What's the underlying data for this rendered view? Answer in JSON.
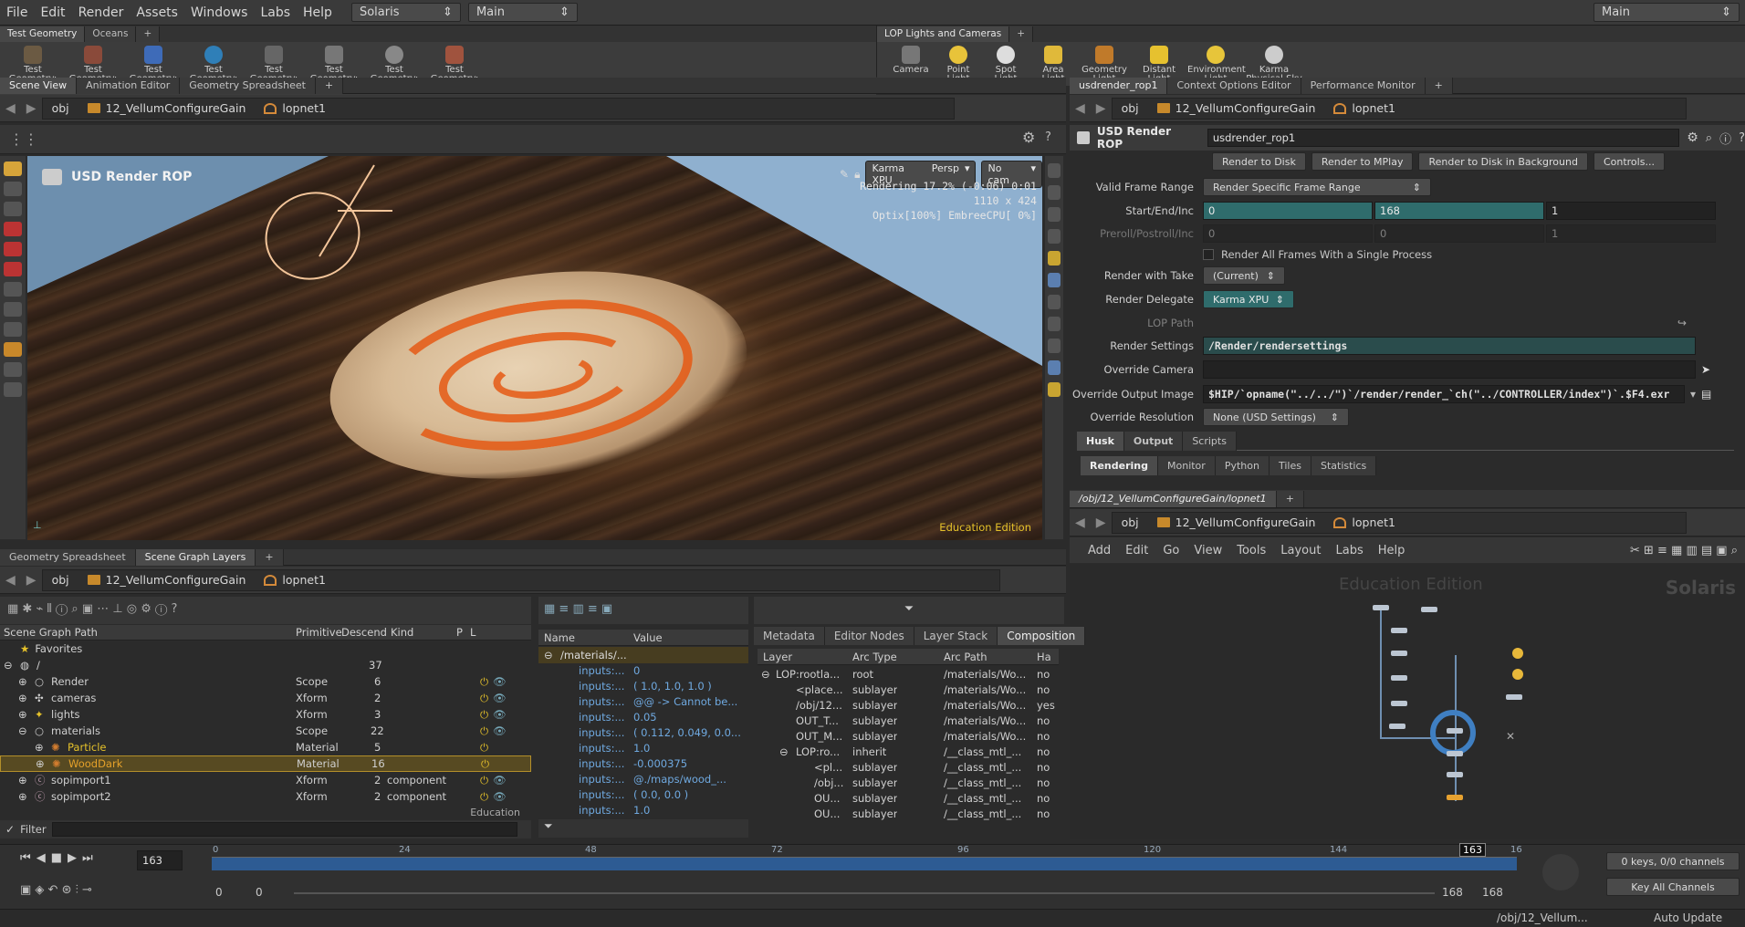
{
  "menu": [
    "File",
    "Edit",
    "Render",
    "Assets",
    "Windows",
    "Labs",
    "Help"
  ],
  "desktop_select": "Solaris",
  "main_select": "Main",
  "top_right_select": "Main",
  "shelf_left": {
    "tabs": [
      "Test Geometry",
      "Oceans"
    ],
    "tools": [
      "Test Geometry: C...",
      "Test Geometry: P...",
      "Test Geometry: R...",
      "Test Geometry: S...",
      "Test Geometry: S...",
      "Test Geometry: T...",
      "Test Geometry: T...",
      "Test Geometry: T..."
    ]
  },
  "shelf_right": {
    "tabs": [
      "LOP Lights and Cameras"
    ],
    "tools": [
      "Camera",
      "Point Light",
      "Spot Light",
      "Area Light",
      "Geometry Light",
      "Distant Light",
      "Environment Light",
      "Karma Physical Sky"
    ]
  },
  "scene_view": {
    "tabs": [
      "Scene View",
      "Animation Editor",
      "Geometry Spreadsheet"
    ],
    "path": [
      "obj",
      "12_VellumConfigureGain",
      "lopnet1"
    ],
    "title": "USD Render ROP",
    "renderer": "Karma XPU",
    "persp": "Persp",
    "cam": "No cam",
    "status_line1": "Rendering  17.2%  (-0:06)  0:01",
    "status_line2": "1110 x 424",
    "status_line3": "Optix[100%] EmbreeCPU[  0%]",
    "watermark": "Education Edition"
  },
  "params": {
    "tabs": [
      "usdrender_rop1",
      "Context Options Editor",
      "Performance Monitor"
    ],
    "path": [
      "obj",
      "12_VellumConfigureGain",
      "lopnet1"
    ],
    "node_type": "USD Render ROP",
    "node_name": "usdrender_rop1",
    "buttons": [
      "Render to Disk",
      "Render to MPlay",
      "Render to Disk in Background",
      "Controls..."
    ],
    "valid_frame_range_label": "Valid Frame Range",
    "valid_frame_range": "Render Specific Frame Range",
    "start_end_inc_label": "Start/End/Inc",
    "start": "0",
    "end": "168",
    "inc": "1",
    "preroll_label": "Preroll/Postroll/Inc",
    "preroll": "0",
    "postroll": "0",
    "preroll_inc": "1",
    "render_all_frames": "Render All Frames With a Single Process",
    "render_with_take_label": "Render with Take",
    "render_with_take": "(Current)",
    "render_delegate_label": "Render Delegate",
    "render_delegate": "Karma XPU",
    "lop_path_label": "LOP Path",
    "render_settings_label": "Render Settings",
    "render_settings": "/Render/rendersettings",
    "override_camera_label": "Override Camera",
    "override_output_label": "Override Output Image",
    "override_output": "$HIP/`opname(\"../../\")`/render/render_`ch(\"../CONTROLLER/index\")`.$F4.exr",
    "override_res_label": "Override Resolution",
    "override_res": "None (USD Settings)",
    "section_tabs": [
      "Husk",
      "Output",
      "Scripts"
    ],
    "sub_tabs": [
      "Rendering",
      "Monitor",
      "Python",
      "Tiles",
      "Statistics"
    ]
  },
  "network": {
    "tab": "/obj/12_VellumConfigureGain/lopnet1",
    "path": [
      "obj",
      "12_VellumConfigureGain",
      "lopnet1"
    ],
    "menu": [
      "Add",
      "Edit",
      "Go",
      "View",
      "Tools",
      "Layout",
      "Labs",
      "Help"
    ],
    "watermark": "Education Edition",
    "context": "Solaris"
  },
  "scene_graph": {
    "tabs": [
      "Geometry Spreadsheet",
      "Scene Graph Layers"
    ],
    "path": [
      "obj",
      "12_VellumConfigureGain",
      "lopnet1"
    ],
    "columns": [
      "Scene Graph Path",
      "Primitive",
      "Descend",
      "Kind",
      "P",
      "L"
    ],
    "favorites": "Favorites",
    "rows": [
      {
        "name": "/",
        "prim": "",
        "desc": "37",
        "kind": ""
      },
      {
        "name": "Render",
        "prim": "Scope",
        "desc": "6",
        "kind": ""
      },
      {
        "name": "cameras",
        "prim": "Xform",
        "desc": "2",
        "kind": ""
      },
      {
        "name": "lights",
        "prim": "Xform",
        "desc": "3",
        "kind": ""
      },
      {
        "name": "materials",
        "prim": "Scope",
        "desc": "22",
        "kind": ""
      },
      {
        "name": "Particle",
        "prim": "Material",
        "desc": "5",
        "kind": ""
      },
      {
        "name": "WoodDark",
        "prim": "Material",
        "desc": "16",
        "kind": ""
      },
      {
        "name": "sopimport1",
        "prim": "Xform",
        "desc": "2",
        "kind": "component"
      },
      {
        "name": "sopimport2",
        "prim": "Xform",
        "desc": "2",
        "kind": "component"
      }
    ],
    "education": "Education",
    "filter": "Filter"
  },
  "attributes": {
    "columns": [
      "Name",
      "Value"
    ],
    "root": "/materials/...",
    "rows": [
      {
        "name": "inputs:...",
        "value": "0"
      },
      {
        "name": "inputs:...",
        "value": "( 1.0, 1.0, 1.0 )"
      },
      {
        "name": "inputs:...",
        "value": "@@ -> Cannot be..."
      },
      {
        "name": "inputs:...",
        "value": "0.05"
      },
      {
        "name": "inputs:...",
        "value": "( 0.112, 0.049, 0.0..."
      },
      {
        "name": "inputs:...",
        "value": "1.0"
      },
      {
        "name": "inputs:...",
        "value": "-0.000375"
      },
      {
        "name": "inputs:...",
        "value": "@./maps/wood_..."
      },
      {
        "name": "inputs:...",
        "value": "( 0.0, 0.0 )"
      },
      {
        "name": "inputs:...",
        "value": "1.0"
      }
    ]
  },
  "composition": {
    "tabs": [
      "Metadata",
      "Editor Nodes",
      "Layer Stack",
      "Composition"
    ],
    "columns": [
      "Layer",
      "Arc Type",
      "Arc Path",
      "Ha"
    ],
    "rows": [
      {
        "layer": "LOP:rootla...",
        "arc": "root",
        "path": "/materials/Wo...",
        "ha": "no"
      },
      {
        "layer": "<place...",
        "arc": "sublayer",
        "path": "/materials/Wo...",
        "ha": "no"
      },
      {
        "layer": "/obj/12...",
        "arc": "sublayer",
        "path": "/materials/Wo...",
        "ha": "yes"
      },
      {
        "layer": "OUT_T...",
        "arc": "sublayer",
        "path": "/materials/Wo...",
        "ha": "no"
      },
      {
        "layer": "OUT_M...",
        "arc": "sublayer",
        "path": "/materials/Wo...",
        "ha": "no"
      },
      {
        "layer": "LOP:ro...",
        "arc": "inherit",
        "path": "/__class_mtl_...",
        "ha": "no"
      },
      {
        "layer": "<pl...",
        "arc": "sublayer",
        "path": "/__class_mtl_...",
        "ha": "no"
      },
      {
        "layer": "/obj...",
        "arc": "sublayer",
        "path": "/__class_mtl_...",
        "ha": "no"
      },
      {
        "layer": "OU...",
        "arc": "sublayer",
        "path": "/__class_mtl_...",
        "ha": "no"
      },
      {
        "layer": "OU...",
        "arc": "sublayer",
        "path": "/__class_mtl_...",
        "ha": "no"
      }
    ]
  },
  "timeline": {
    "frame": "163",
    "ticks": [
      "0",
      "24",
      "48",
      "72",
      "96",
      "120",
      "144",
      "16"
    ],
    "playhead": "163",
    "range_start": "0",
    "range_start2": "0",
    "range_end": "168",
    "range_end2": "168",
    "keys": "0 keys, 0/0 channels",
    "key_all": "Key All Channels",
    "status_path": "/obj/12_Vellum...",
    "auto_update": "Auto Update"
  }
}
